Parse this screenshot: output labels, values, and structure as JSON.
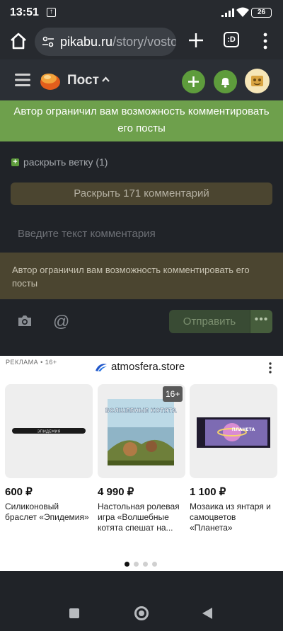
{
  "status": {
    "time": "13:51",
    "battery": "26"
  },
  "browser": {
    "url_host": "pikabu.ru",
    "url_path": "/story/vostoc",
    "tabs_label": ":D"
  },
  "header": {
    "title": "Пост"
  },
  "banner": {
    "text": "Автор ограничил вам возможность комментировать его посты"
  },
  "comments": {
    "expand_branch": "раскрыть ветку (1)",
    "expand_all": "Раскрыть 171 комментарий",
    "input_placeholder": "Введите текст комментария",
    "restriction": "Автор ограничил вам возможность комментировать его посты",
    "send_label": "Отправить",
    "more_label": "•••"
  },
  "ad": {
    "label": "РЕКЛАМА • 16+",
    "brand": "atmosfera.store",
    "age_badge": "16+",
    "products": [
      {
        "price": "600 ₽",
        "title": "Силиконовый браслет «Эпидемия»",
        "image_text": "ЭПИДЕМИЯ"
      },
      {
        "price": "4 990 ₽",
        "title": "Настольная ролевая игра «Волшебные котята спешат на...",
        "image_text": "ВОЛШЕБНЫЕ КОТЯТА"
      },
      {
        "price": "1 100 ₽",
        "title": "Мозаика из янтаря и самоцветов «Планета»",
        "image_text": "ПЛАНЕТА"
      }
    ]
  },
  "colors": {
    "accent_green": "#5e9c3c",
    "banner_green": "#6ea04c",
    "warn_bg": "#4b4530"
  }
}
